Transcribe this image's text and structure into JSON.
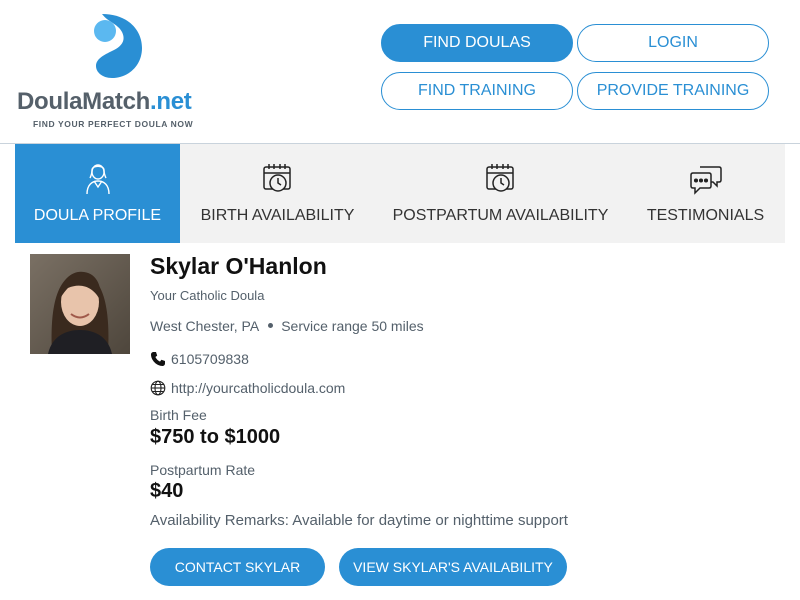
{
  "logo": {
    "name_main": "DoulaMatch",
    "name_suffix": ".net",
    "tagline": "FIND YOUR PERFECT DOULA NOW"
  },
  "nav": {
    "find_doulas": "FIND DOULAS",
    "login": "LOGIN",
    "find_training": "FIND TRAINING",
    "provide_training": "PROVIDE TRAINING"
  },
  "tabs": [
    {
      "label": "DOULA PROFILE",
      "icon": "doula-person-icon",
      "active": true
    },
    {
      "label": "BIRTH AVAILABILITY",
      "icon": "calendar-clock-icon",
      "active": false
    },
    {
      "label": "POSTPARTUM AVAILABILITY",
      "icon": "calendar-clock-icon",
      "active": false
    },
    {
      "label": "TESTIMONIALS",
      "icon": "chat-bubbles-icon",
      "active": false
    }
  ],
  "profile": {
    "name": "Skylar O'Hanlon",
    "business": "Your Catholic Doula",
    "location": "West Chester, PA",
    "service_range": "Service range 50 miles",
    "phone": "6105709838",
    "website": "http://yourcatholicdoula.com",
    "birth_fee_label": "Birth Fee",
    "birth_fee": "$750 to $1000",
    "postpartum_rate_label": "Postpartum Rate",
    "postpartum_rate": "$40",
    "remarks": "Availability Remarks: Available for daytime or nighttime support"
  },
  "actions": {
    "contact": "CONTACT SKYLAR",
    "availability": "VIEW SKYLAR'S AVAILABILITY"
  },
  "colors": {
    "accent": "#2a8fd4",
    "tab_bg": "#f2f2f2",
    "text_muted": "#54606b"
  }
}
